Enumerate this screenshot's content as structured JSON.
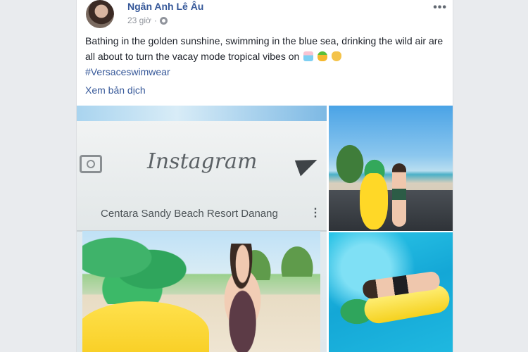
{
  "post": {
    "author": "Ngân Anh Lê Âu",
    "time": "23 giờ",
    "more_label": "•••",
    "text": "Bathing in the golden sunshine, swimming in the blue sea, drinking the wild air are all about to turn the vacay mode tropical vibes on",
    "hashtag": "#Versaceswimwear",
    "translate_link": "Xem bản dịch"
  },
  "photo_main": {
    "overlay_title": "Instagram",
    "overlay_location": "Centara Sandy Beach Resort Danang",
    "overlay_menu": "⋮"
  },
  "icons": [
    "globe-icon",
    "more-options-icon",
    "camera-icon",
    "send-icon"
  ],
  "colors": {
    "link": "#365899",
    "text": "#1d2129",
    "meta": "#90949c",
    "background": "#e9ebee"
  }
}
